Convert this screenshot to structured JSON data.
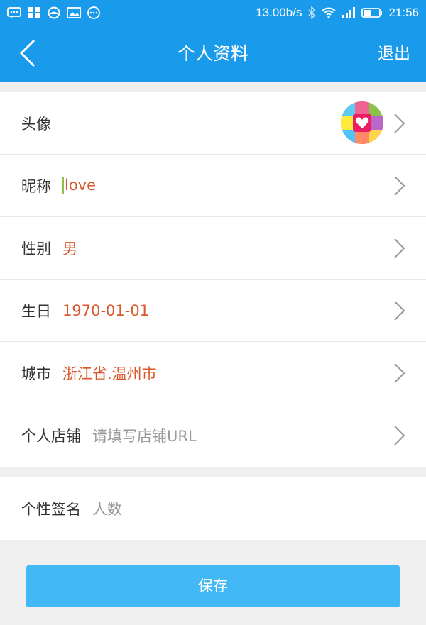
{
  "status_bar": {
    "network_speed": "13.00b/s",
    "time": "21:56",
    "icons": [
      "message-icon",
      "apps-icon",
      "weather-icon",
      "image-icon",
      "more-icon",
      "bluetooth-icon",
      "wifi-icon",
      "signal-icon",
      "battery-icon"
    ]
  },
  "header": {
    "title": "个人资料",
    "logout_label": "退出",
    "back_icon": "back-arrow-icon",
    "background": "#1a9aea"
  },
  "profile": {
    "rows": [
      {
        "label": "头像",
        "value": ""
      },
      {
        "label": "昵称",
        "value": "love"
      },
      {
        "label": "性别",
        "value": "男"
      },
      {
        "label": "生日",
        "value": "1970-01-01"
      },
      {
        "label": "城市",
        "value": "浙江省.温州市"
      },
      {
        "label": "个人店铺",
        "placeholder": "请填写店铺URL"
      }
    ]
  },
  "signature": {
    "label": "个性签名",
    "placeholder": "人数"
  },
  "actions": {
    "save_label": "保存",
    "save_color": "#42b8f6"
  },
  "colors": {
    "value_text": "#d9572c",
    "placeholder_text": "#999999"
  }
}
